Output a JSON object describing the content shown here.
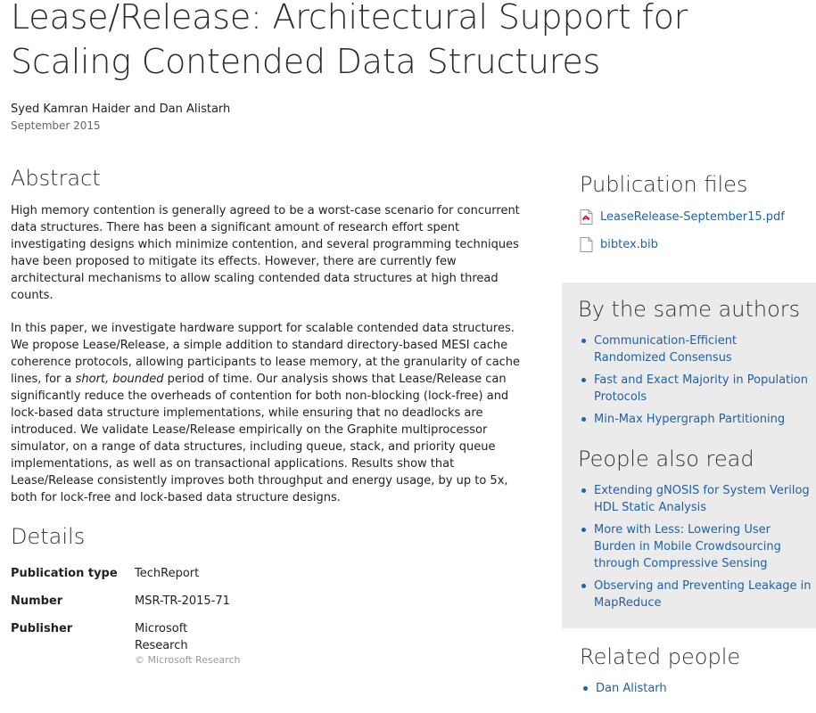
{
  "title": "Lease/Release: Architectural Support for Scaling Contended Data Structures",
  "authors": "Syed Kamran Haider and Dan Alistarh",
  "date": "September 2015",
  "abstract": {
    "heading": "Abstract",
    "p1": "High memory contention is generally agreed to be a worst-case scenario for concurrent data structures. There has been a significant amount of research effort spent investigating designs which minimize contention, and several programming techniques have been proposed to mitigate its effects. However, there are currently few architectural mechanisms to allow scaling contended data structures at high thread counts.",
    "p2_before": "In this paper, we investigate hardware support for scalable contended data structures. We propose Lease/Release, a simple addition to standard directory-based MESI cache coherence protocols, allowing participants to lease memory, at the granularity of cache lines, for a ",
    "p2_emphasis": "short, bounded",
    "p2_after": " period of time. Our analysis shows that Lease/Release can significantly reduce the overheads of contention for both non-blocking (lock-free) and lock-based data structure implementations, while ensuring that no deadlocks are introduced. We validate Lease/Release empirically on the Graphite multiprocessor simulator, on a range of data structures, including queue, stack, and priority queue implementations, as well as on transactional applications. Results show that Lease/Release consistently improves both throughput and energy usage, by up to 5x, both for lock-free and lock-based data structure designs."
  },
  "details": {
    "heading": "Details",
    "rows": [
      {
        "label": "Publication type",
        "value": "TechReport"
      },
      {
        "label": "Number",
        "value": "MSR-TR-2015-71"
      },
      {
        "label": "Publisher",
        "value": "Microsoft Research"
      }
    ],
    "copyright": "© Microsoft Research"
  },
  "files": {
    "heading": "Publication files",
    "items": [
      {
        "name": "LeaseRelease-September15.pdf",
        "icon": "pdf-file-icon"
      },
      {
        "name": "bibtex.bib",
        "icon": "document-icon"
      }
    ]
  },
  "same_authors": {
    "heading": "By the same authors",
    "items": [
      "Communication-Efficient Randomized Consensus",
      "Fast and Exact Majority in Population Protocols",
      "Min-Max Hypergraph Partitioning"
    ]
  },
  "also_read": {
    "heading": "People also read",
    "items": [
      "Extending gNOSIS for System Verilog HDL Static Analysis",
      "More with Less: Lowering User Burden in Mobile Crowdsourcing through Compressive Sensing",
      "Observing and Preventing Leakage in MapReduce"
    ]
  },
  "related": {
    "heading": "Related people",
    "items": [
      "Dan Alistarh"
    ]
  },
  "colors": {
    "link": "#1f62a6",
    "sidebar_bg": "#ebebeb",
    "muted": "#666666"
  }
}
